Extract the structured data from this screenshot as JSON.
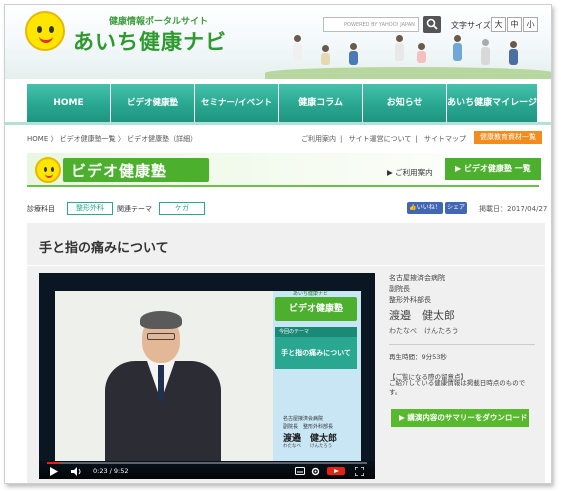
{
  "header": {
    "tagline": "健康情報ポータルサイト",
    "site_name": "あいち健康ナビ",
    "search_brand": "POWERED BY YAHOO! JAPAN",
    "font_size_label": "文字サイズ",
    "font_sizes": [
      "大",
      "中",
      "小"
    ]
  },
  "nav": {
    "items": [
      "HOME",
      "ビデオ健康塾",
      "セミナー/イベント",
      "健康コラム",
      "お知らせ",
      "あいち健康マイレージ"
    ]
  },
  "breadcrumb": "HOME 〉 ビデオ健康塾一覧 〉 ビデオ健康塾（詳細）",
  "top_links": [
    "ご利用案内",
    "サイト運営について",
    "サイトマップ"
  ],
  "material_badge": "健康教育資材一覧",
  "banner": {
    "title": "ビデオ健康塾",
    "guide_link": "ご利用案内",
    "list_button": "ビデオ健康塾 一覧"
  },
  "tags": {
    "category_label": "診療科目",
    "category_value": "整形外科",
    "theme_label": "関連テーマ",
    "theme_value": "ケガ",
    "like_label": "いいね！",
    "share_label": "シェア",
    "post_date": "掲載日：2017/04/27"
  },
  "article": {
    "title": "手と指の痛みについて"
  },
  "video": {
    "brand_small": "あいち健康ナビ",
    "brand": "ビデオ健康塾",
    "theme_label": "今回のテーマ",
    "theme": "手と指の痛みについて",
    "org": "名古屋掖済会病院",
    "dept": "副院長　整形外科部長",
    "name": "渡邉　健太郎",
    "kana": "わたなべ　　けんたろう",
    "time": "0:23 / 9:52",
    "progress": 0.04
  },
  "speaker": {
    "hospital": "名古屋掖済会病院",
    "position1": "副院長",
    "position2": "整形外科部長",
    "name": "渡邉　健太郎",
    "kana": "わたなべ　けんたろう",
    "playtime": "再生時間：9分53秒"
  },
  "notes": {
    "title": "【ご覧になる際の留意点】",
    "text": "ご紹介している健康情報は掲載日時点のものです。"
  },
  "summary_button": "講演内容のサマリーをダウンロード",
  "colors": {
    "nav_green": "#2aa790",
    "brand_green": "#4caf2e",
    "badge_orange": "#f28c1e",
    "facebook_blue": "#4267b2",
    "progress_red": "#e62117"
  }
}
